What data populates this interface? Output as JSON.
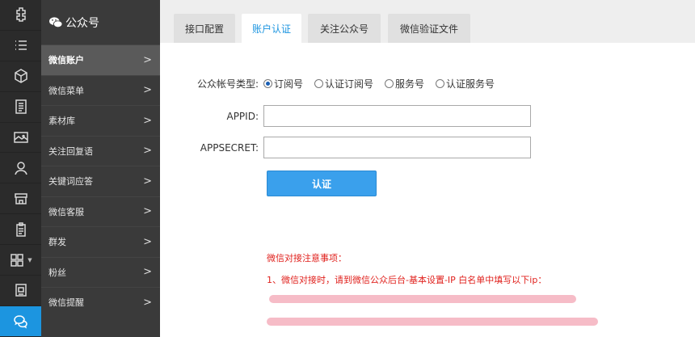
{
  "rail": {
    "items": [
      {
        "icon": "puzzle-icon"
      },
      {
        "icon": "list-icon"
      },
      {
        "icon": "cube-icon"
      },
      {
        "icon": "document-icon"
      },
      {
        "icon": "image-icon"
      },
      {
        "icon": "user-icon"
      },
      {
        "icon": "store-icon"
      },
      {
        "icon": "clipboard-icon"
      },
      {
        "icon": "grid-icon"
      },
      {
        "icon": "monitor-icon"
      },
      {
        "icon": "wechat-icon"
      }
    ],
    "active_index": 10
  },
  "sidebar": {
    "title": "公众号",
    "items": [
      {
        "label": "微信账户",
        "active": true
      },
      {
        "label": "微信菜单"
      },
      {
        "label": "素材库"
      },
      {
        "label": "关注回复语"
      },
      {
        "label": "关键词应答"
      },
      {
        "label": "微信客服"
      },
      {
        "label": "群发"
      },
      {
        "label": "粉丝"
      },
      {
        "label": "微信提醒"
      }
    ],
    "arrow": ">"
  },
  "tabs": [
    {
      "label": "接口配置"
    },
    {
      "label": "账户认证",
      "active": true
    },
    {
      "label": "关注公众号"
    },
    {
      "label": "微信验证文件"
    }
  ],
  "form": {
    "account_type_label": "公众帐号类型:",
    "account_types": [
      {
        "label": "订阅号",
        "checked": true
      },
      {
        "label": "认证订阅号"
      },
      {
        "label": "服务号"
      },
      {
        "label": "认证服务号"
      }
    ],
    "appid_label": "APPID:",
    "appid_value": "",
    "appsecret_label": "APPSECRET:",
    "appsecret_value": "",
    "submit_label": "认证"
  },
  "notice": {
    "title": "微信对接注意事项：",
    "line1": "1、微信对接时，请到微信公众后台-基本设置-IP 白名单中填写以下ip："
  },
  "colors": {
    "accent": "#1c95e0",
    "button": "#3aa0ec",
    "notice": "#e0211d",
    "rail_bg": "#2b2b2b",
    "sidebar_bg": "#3a3a3a"
  }
}
